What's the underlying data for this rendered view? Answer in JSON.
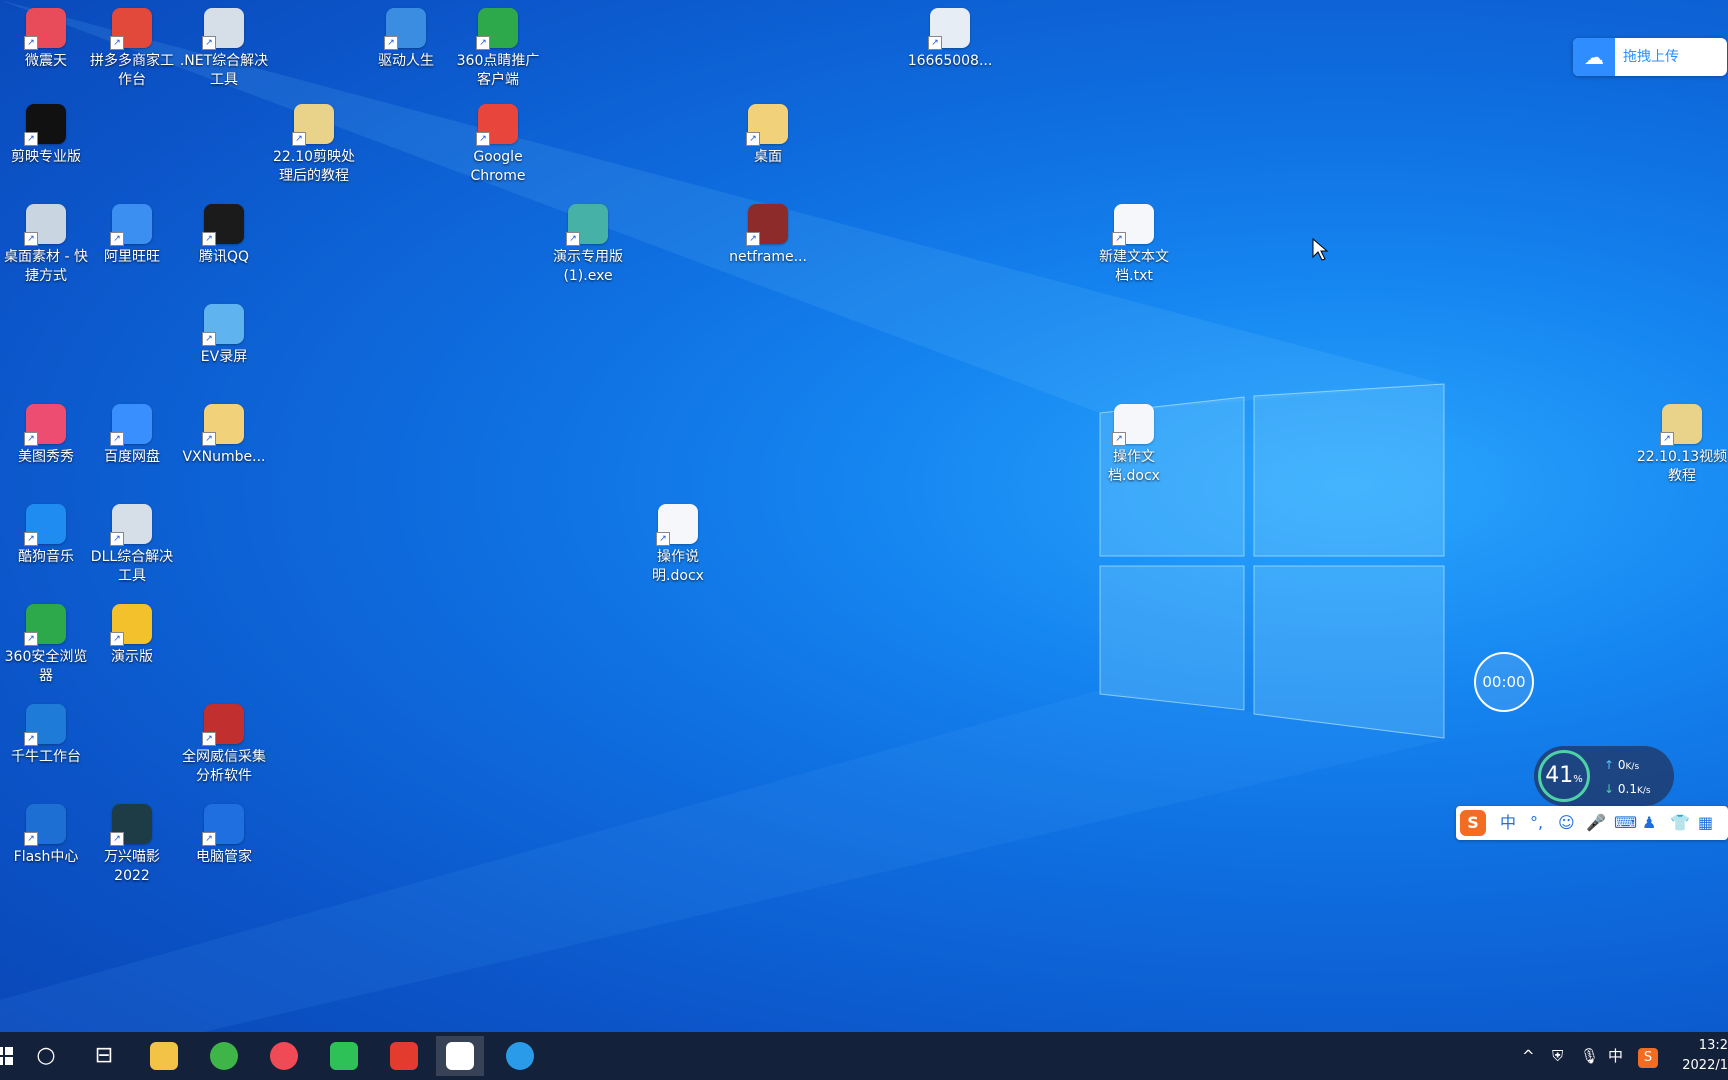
{
  "desktop": {
    "icons": [
      {
        "label": "微震天",
        "color": "#e84b5a"
      },
      {
        "label": "拼多多商家工作台",
        "color": "#e2493b"
      },
      {
        "label": ".NET综合解决工具",
        "color": "#d6dfe8"
      },
      {
        "label": "驱动人生",
        "color": "#3a8de0"
      },
      {
        "label": "360点睛推广客户端",
        "color": "#2da84a"
      },
      {
        "label": "16665008...",
        "color": "#e6edf5"
      },
      {
        "label": "剪映专业版",
        "color": "#111111"
      },
      {
        "label": "22.10剪映处理后的教程",
        "color": "#e9d38a"
      },
      {
        "label": "Google Chrome",
        "color": "#e8453c"
      },
      {
        "label": "桌面",
        "color": "#f1d27a"
      },
      {
        "label": "桌面素材 - 快捷方式",
        "color": "#c9d6e2"
      },
      {
        "label": "阿里旺旺",
        "color": "#3b8ff0"
      },
      {
        "label": "腾讯QQ",
        "color": "#1b1b1b"
      },
      {
        "label": "演示专用版(1).exe",
        "color": "#46b1a6"
      },
      {
        "label": "netframe...",
        "color": "#8d2b2b"
      },
      {
        "label": "新建文本文档.txt",
        "color": "#f5f7fa"
      },
      {
        "label": "EV录屏",
        "color": "#5fb4ef"
      },
      {
        "label": "美图秀秀",
        "color": "#ee4d72"
      },
      {
        "label": "百度网盘",
        "color": "#3a8fff"
      },
      {
        "label": "VXNumbe...",
        "color": "#f1d27a"
      },
      {
        "label": "操作文档.docx",
        "color": "#f5f7fa"
      },
      {
        "label": "22.10.13视频教程",
        "color": "#e9d38a"
      },
      {
        "label": "酷狗音乐",
        "color": "#1e8cf0"
      },
      {
        "label": "DLL综合解决工具",
        "color": "#d6dfe8"
      },
      {
        "label": "操作说明.docx",
        "color": "#f5f7fa"
      },
      {
        "label": "360安全浏览器",
        "color": "#2da84a"
      },
      {
        "label": "演示版",
        "color": "#f3c12c"
      },
      {
        "label": "千牛工作台",
        "color": "#1f7bd8"
      },
      {
        "label": "全网威信采集分析软件",
        "color": "#c22f2f"
      },
      {
        "label": "Flash中心",
        "color": "#1d6fd4"
      },
      {
        "label": "万兴喵影 2022",
        "color": "#1e3c46"
      },
      {
        "label": "电脑管家",
        "color": "#1f6fe0"
      }
    ]
  },
  "baidu_upload": {
    "label": "拖拽上传",
    "icon": "cloud-icon"
  },
  "timer": {
    "value": "00:00"
  },
  "net_monitor": {
    "percent": "41",
    "percent_unit": "%",
    "up": "0",
    "down": "0.1",
    "unit": "K/s"
  },
  "ime_bar": {
    "logo": "S",
    "mode": "中",
    "items": [
      "punct-icon",
      "emoji-icon",
      "mic-icon",
      "keyboard-icon",
      "user-icon",
      "skin-icon",
      "grid-icon"
    ]
  },
  "taskbar": {
    "apps": [
      "start",
      "search-cortana",
      "task-view",
      "file-explorer",
      "360-browser",
      "red-app",
      "wechat",
      "wps-office",
      "baidu-netdisk",
      "edge"
    ],
    "tray": {
      "expand": "^",
      "ime_mode": "中",
      "clock_time": "13:2",
      "clock_date": "2022/1"
    }
  }
}
